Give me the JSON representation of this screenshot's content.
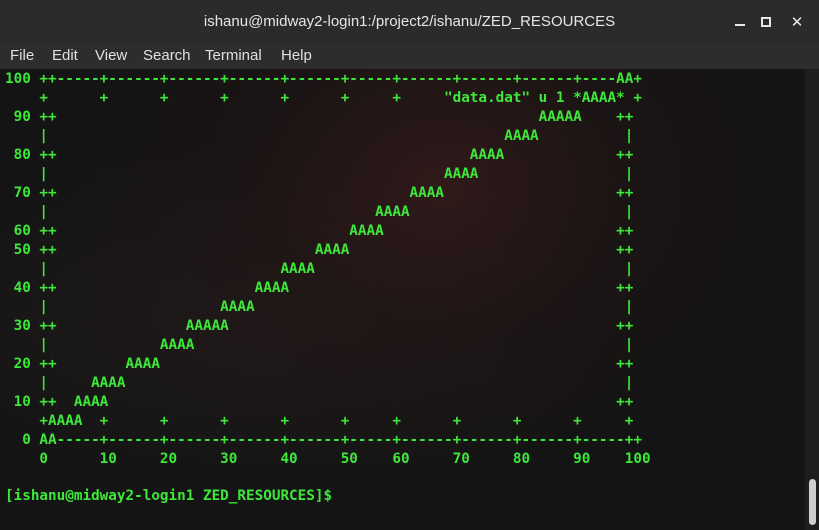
{
  "window": {
    "title": "ishanu@midway2-login1:/project2/ishanu/ZED_RESOURCES",
    "close_glyph": "✕"
  },
  "menu": {
    "items": [
      "File",
      "Edit",
      "View",
      "Search",
      "Terminal",
      "Help"
    ]
  },
  "terminal": {
    "plot_lines": [
      "100 ++-----+------+------+------+------+-----+------+------+------+----AA+",
      "    +      +      +      +      +      +     +     \"data.dat\" u 1 *AAAA* +",
      " 90 ++                                                        AAAAA    ++",
      "    |                                                     AAAA          |",
      " 80 ++                                                AAAA             ++",
      "    |                                              AAAA                 |",
      " 70 ++                                         AAAA                    ++",
      "    |                                      AAAA                         |",
      " 60 ++                                  AAAA                           ++",
      " 50 ++                              AAAA                               ++",
      "    |                           AAAA                                    |",
      " 40 ++                       AAAA                                      ++",
      "    |                    AAAA                                           |",
      " 30 ++               AAAAA                                             ++",
      "    |             AAAA                                                  |",
      " 20 ++        AAAA                                                     ++",
      "    |     AAAA                                                          |",
      " 10 ++  AAAA                                                           ++",
      "    +AAAA  +      +      +      +      +     +      +      +      +     +",
      "  0 AA-----+------+------+------+------+-----+------+------+------+-----++",
      "    0      10     20     30     40     50    60     70     80     90    100"
    ],
    "prompt": "[ishanu@midway2-login1 ZED_RESOURCES]$ "
  },
  "colors": {
    "terminal_text": "#3ee83a",
    "terminal_bg": "#141414",
    "titlebar_bg": "#2b2b2b"
  }
}
